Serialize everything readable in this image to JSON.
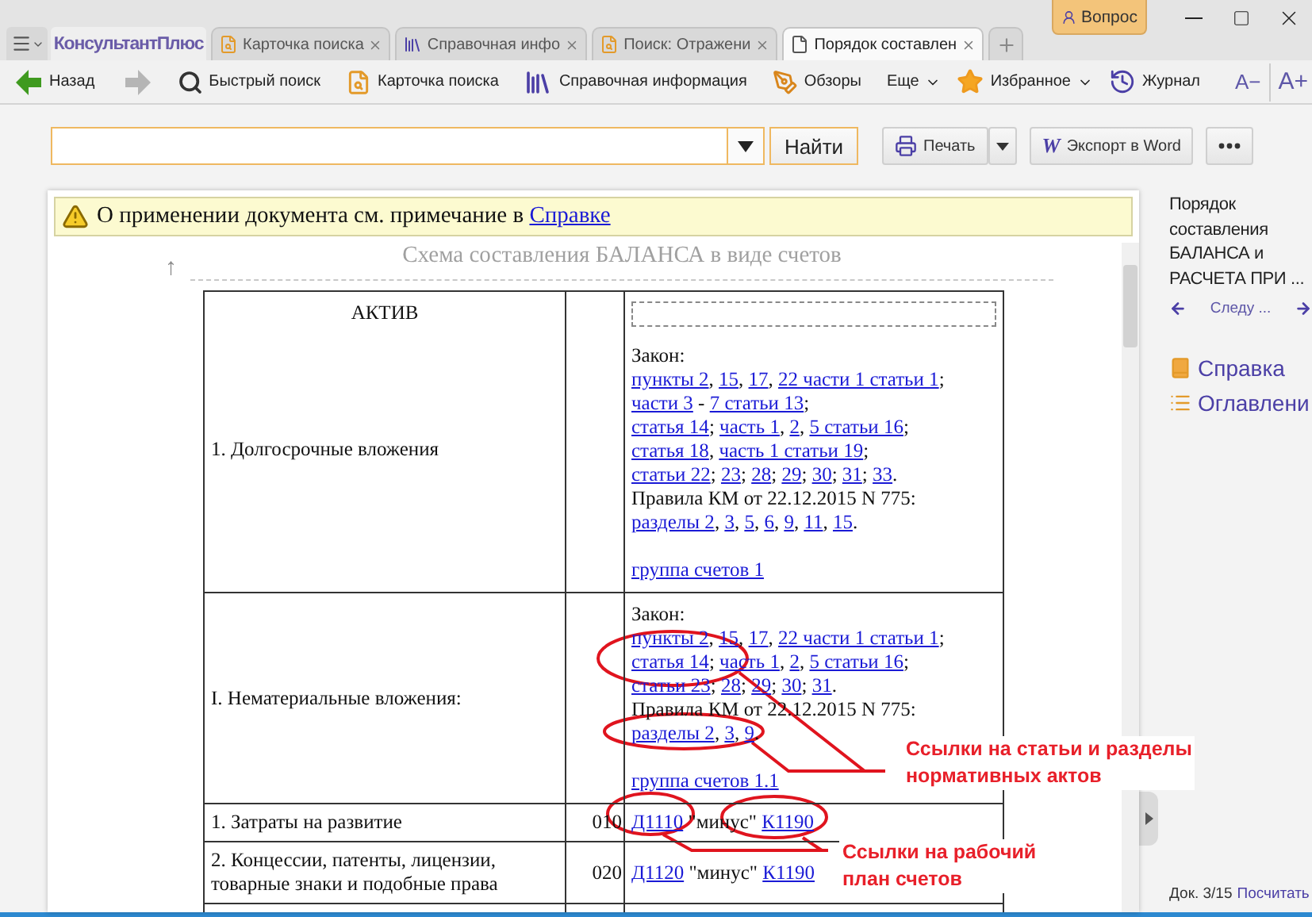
{
  "title_bar": {
    "logo": "КонсультантПлюс",
    "question_button": "Вопрос",
    "tabs": [
      {
        "label": "Карточка поиска",
        "selected": false
      },
      {
        "label": "Справочная инфо",
        "selected": false
      },
      {
        "label": "Поиск: Отражени",
        "selected": false
      },
      {
        "label": "Порядок составлен",
        "selected": true
      }
    ]
  },
  "toolbar": {
    "back": {
      "label": "Назад",
      "disabled": false
    },
    "forward": {
      "disabled": true
    },
    "items": [
      "Быстрый поиск",
      "Карточка поиска",
      "Справочная информация",
      "Обзоры"
    ],
    "more": "Еще",
    "favorites": "Избранное",
    "history": "Журнал",
    "font_smaller": "A−",
    "font_larger": "A+"
  },
  "search": {
    "button": "Найти",
    "print": "Печать",
    "export": {
      "icon_text": "W",
      "label": "Экспорт в Word"
    }
  },
  "notice": {
    "text": "О применении документа см. примечание в ",
    "link": "Справке"
  },
  "document": {
    "up_arrow": "↑",
    "title": "Схема составления БАЛАНСА в виде счетов",
    "rows": [
      {
        "kind": "section",
        "header": "АКТИВ",
        "name": "1. Долгосрочные вложения",
        "refs": [
          {
            "gap": false,
            "parts": [
              {
                "text": "Закон:",
                "link": false
              }
            ]
          },
          {
            "gap": false,
            "parts": [
              {
                "text": "пункты 2",
                "link": true
              },
              {
                "text": ", ",
                "link": false
              },
              {
                "text": "15",
                "link": true
              },
              {
                "text": ", ",
                "link": false
              },
              {
                "text": "17",
                "link": true
              },
              {
                "text": ", ",
                "link": false
              },
              {
                "text": "22 части 1 статьи 1",
                "link": true
              },
              {
                "text": ";",
                "link": false
              }
            ]
          },
          {
            "gap": false,
            "parts": [
              {
                "text": "части 3",
                "link": true
              },
              {
                "text": " - ",
                "link": false
              },
              {
                "text": "7 статьи 13",
                "link": true
              },
              {
                "text": ";",
                "link": false
              }
            ]
          },
          {
            "gap": false,
            "parts": [
              {
                "text": "статья 14",
                "link": true
              },
              {
                "text": "; ",
                "link": false
              },
              {
                "text": "часть 1",
                "link": true
              },
              {
                "text": ", ",
                "link": false
              },
              {
                "text": "2",
                "link": true
              },
              {
                "text": ", ",
                "link": false
              },
              {
                "text": "5 статьи 16",
                "link": true
              },
              {
                "text": ";",
                "link": false
              }
            ]
          },
          {
            "gap": false,
            "parts": [
              {
                "text": "статья 18",
                "link": true
              },
              {
                "text": ", ",
                "link": false
              },
              {
                "text": "часть 1 статьи 19",
                "link": true
              },
              {
                "text": ";",
                "link": false
              }
            ]
          },
          {
            "gap": false,
            "parts": [
              {
                "text": "статьи 22",
                "link": true
              },
              {
                "text": "; ",
                "link": false
              },
              {
                "text": "23",
                "link": true
              },
              {
                "text": "; ",
                "link": false
              },
              {
                "text": "28",
                "link": true
              },
              {
                "text": "; ",
                "link": false
              },
              {
                "text": "29",
                "link": true
              },
              {
                "text": "; ",
                "link": false
              },
              {
                "text": "30",
                "link": true
              },
              {
                "text": "; ",
                "link": false
              },
              {
                "text": "31",
                "link": true
              },
              {
                "text": "; ",
                "link": false
              },
              {
                "text": "33",
                "link": true
              },
              {
                "text": ".",
                "link": false
              }
            ]
          },
          {
            "gap": false,
            "parts": [
              {
                "text": "Правила КМ от 22.12.2015 N 775:",
                "link": false
              }
            ]
          },
          {
            "gap": false,
            "parts": [
              {
                "text": "разделы 2",
                "link": true
              },
              {
                "text": ", ",
                "link": false
              },
              {
                "text": "3",
                "link": true
              },
              {
                "text": ", ",
                "link": false
              },
              {
                "text": "5",
                "link": true
              },
              {
                "text": ", ",
                "link": false
              },
              {
                "text": "6",
                "link": true
              },
              {
                "text": ", ",
                "link": false
              },
              {
                "text": "9",
                "link": true
              },
              {
                "text": ", ",
                "link": false
              },
              {
                "text": "11",
                "link": true
              },
              {
                "text": ", ",
                "link": false
              },
              {
                "text": "15",
                "link": true
              },
              {
                "text": ".",
                "link": false
              }
            ]
          },
          {
            "gap": true,
            "parts": [
              {
                "text": "группа счетов 1",
                "link": true
              }
            ]
          }
        ]
      },
      {
        "kind": "group",
        "name": "I. Нематериальные вложения:",
        "refs": [
          {
            "gap": false,
            "parts": [
              {
                "text": "Закон:",
                "link": false
              }
            ]
          },
          {
            "gap": false,
            "parts": [
              {
                "text": "пункты 2",
                "link": true
              },
              {
                "text": ", ",
                "link": false
              },
              {
                "text": "15",
                "link": true
              },
              {
                "text": ", ",
                "link": false
              },
              {
                "text": "17",
                "link": true
              },
              {
                "text": ", ",
                "link": false
              },
              {
                "text": "22 части 1 статьи 1",
                "link": true
              },
              {
                "text": ";",
                "link": false
              }
            ]
          },
          {
            "gap": false,
            "parts": [
              {
                "text": "статья 14",
                "link": true
              },
              {
                "text": "; ",
                "link": false
              },
              {
                "text": "часть 1",
                "link": true
              },
              {
                "text": ", ",
                "link": false
              },
              {
                "text": "2",
                "link": true
              },
              {
                "text": ", ",
                "link": false
              },
              {
                "text": "5 статьи 16",
                "link": true
              },
              {
                "text": ";",
                "link": false
              }
            ]
          },
          {
            "gap": false,
            "parts": [
              {
                "text": "статьи 23",
                "link": true
              },
              {
                "text": "; ",
                "link": false
              },
              {
                "text": "28",
                "link": true
              },
              {
                "text": "; ",
                "link": false
              },
              {
                "text": "29",
                "link": true
              },
              {
                "text": "; ",
                "link": false
              },
              {
                "text": "30",
                "link": true
              },
              {
                "text": "; ",
                "link": false
              },
              {
                "text": "31",
                "link": true
              },
              {
                "text": ".",
                "link": false
              }
            ]
          },
          {
            "gap": false,
            "parts": [
              {
                "text": "Правила КМ от 22.12.2015 N 775:",
                "link": false
              }
            ]
          },
          {
            "gap": false,
            "parts": [
              {
                "text": "разделы 2",
                "link": true
              },
              {
                "text": ", ",
                "link": false
              },
              {
                "text": "3",
                "link": true
              },
              {
                "text": ", ",
                "link": false
              },
              {
                "text": "9",
                "link": true
              },
              {
                "text": ".",
                "link": false
              }
            ]
          },
          {
            "gap": true,
            "parts": [
              {
                "text": "группа счетов 1.1",
                "link": true
              }
            ]
          }
        ]
      },
      {
        "kind": "item",
        "name": "1. Затраты на развитие",
        "code": "010",
        "refs": [
          {
            "gap": false,
            "parts": [
              {
                "text": "Д1110",
                "link": true
              },
              {
                "text": " \"минус\" ",
                "link": false
              },
              {
                "text": "К1190",
                "link": true
              }
            ]
          }
        ]
      },
      {
        "kind": "item",
        "name": "2. Концессии, патенты, лицензии, товарные знаки и подобные права",
        "code": "020",
        "refs": [
          {
            "gap": false,
            "parts": [
              {
                "text": "Д1120",
                "link": true
              },
              {
                "text": " \"минус\" ",
                "link": false
              },
              {
                "text": "К1190",
                "link": true
              }
            ]
          }
        ]
      }
    ]
  },
  "callouts": [
    {
      "lines": [
        "Ссылки на статьи и разделы",
        "нормативных актов"
      ]
    },
    {
      "lines": [
        "Ссылки на рабочий",
        "план счетов"
      ]
    }
  ],
  "sidebar": {
    "title": "Порядок составления БАЛАНСА и РАСЧЕТА ПРИ ...",
    "nav_label": "Следу ...",
    "links": [
      "Справка",
      "Оглавлени"
    ],
    "doc_counter": "Док. 3/15",
    "count_link": "Посчитать"
  }
}
